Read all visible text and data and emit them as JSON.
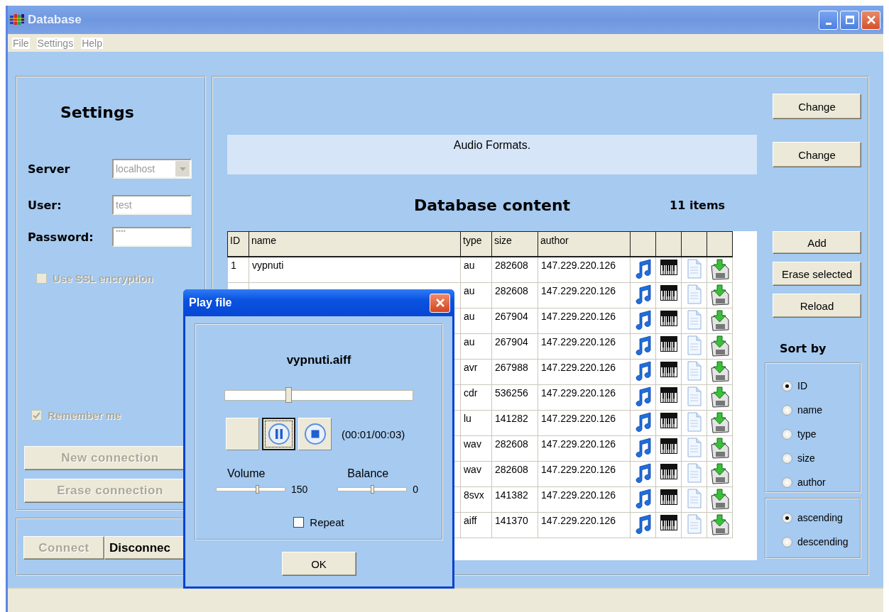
{
  "window": {
    "title": "Database"
  },
  "menu": [
    "File",
    "Settings",
    "Help"
  ],
  "settings_panel": {
    "title": "Settings",
    "server": {
      "label": "Server",
      "value": "localhost",
      "disabled": true
    },
    "user": {
      "label": "User:",
      "value": "test",
      "disabled": true
    },
    "password": {
      "label": "Password:",
      "value": "****",
      "disabled": true
    },
    "ssl": {
      "label": "Use SSL encryption",
      "checked": false,
      "disabled": true
    },
    "remember": {
      "label": "Remember me",
      "checked": true,
      "disabled": true
    },
    "buttons": [
      {
        "label": "New connection",
        "disabled": true
      },
      {
        "label": "Erase connection",
        "disabled": true
      }
    ]
  },
  "connection_panel": {
    "buttons": [
      {
        "label": "Connect",
        "disabled": true
      },
      {
        "label": "Disconnec",
        "disabled": false
      }
    ]
  },
  "content": {
    "info": "Audio Formats.",
    "title": "Database content",
    "count": "11 items",
    "table": {
      "columns": [
        "ID",
        "name",
        "type",
        "size",
        "author"
      ],
      "rows": [
        {
          "id": "1",
          "name": "vypnuti",
          "type": "au",
          "size": "282608",
          "author": "147.229.220.126"
        },
        {
          "type": "au",
          "size": "282608",
          "author": "147.229.220.126"
        },
        {
          "type": "au",
          "size": "267904",
          "author": "147.229.220.126"
        },
        {
          "type": "au",
          "size": "267904",
          "author": "147.229.220.126"
        },
        {
          "type": "avr",
          "size": "267988",
          "author": "147.229.220.126"
        },
        {
          "type": "cdr",
          "size": "536256",
          "author": "147.229.220.126"
        },
        {
          "type": "lu",
          "size": "141282",
          "author": "147.229.220.126"
        },
        {
          "type": "wav",
          "size": "282608",
          "author": "147.229.220.126"
        },
        {
          "type": "wav",
          "size": "282608",
          "author": "147.229.220.126"
        },
        {
          "type": "8svx",
          "size": "141382",
          "author": "147.229.220.126"
        },
        {
          "type": "aiff",
          "size": "141370",
          "author": "147.229.220.126"
        }
      ]
    }
  },
  "side": {
    "change_buttons": [
      "Change",
      "Change"
    ],
    "actions": [
      "Add",
      "Erase selected",
      "Reload"
    ],
    "sort_label": "Sort by",
    "sort_by": [
      {
        "label": "ID",
        "selected": true
      },
      {
        "label": "name",
        "selected": false
      },
      {
        "label": "type",
        "selected": false
      },
      {
        "label": "size",
        "selected": false
      },
      {
        "label": "author",
        "selected": false
      }
    ],
    "order": [
      {
        "label": "ascending",
        "selected": true
      },
      {
        "label": "descending",
        "selected": false
      }
    ]
  },
  "dialog": {
    "title": "Play file",
    "filename": "vypnuti.aiff",
    "seek": {
      "level": 0.34
    },
    "transport": [
      {
        "kind": "blank",
        "pressed": false
      },
      {
        "kind": "pause",
        "pressed": true
      },
      {
        "kind": "stop",
        "pressed": false
      }
    ],
    "time": "(00:01/00:03)",
    "volume": {
      "label": "Volume",
      "level": 0.6,
      "reading": "150"
    },
    "balance": {
      "label": "Balance",
      "level": 0.5,
      "reading": "0"
    },
    "repeat": {
      "label": "Repeat",
      "checked": false
    },
    "ok": "OK"
  }
}
